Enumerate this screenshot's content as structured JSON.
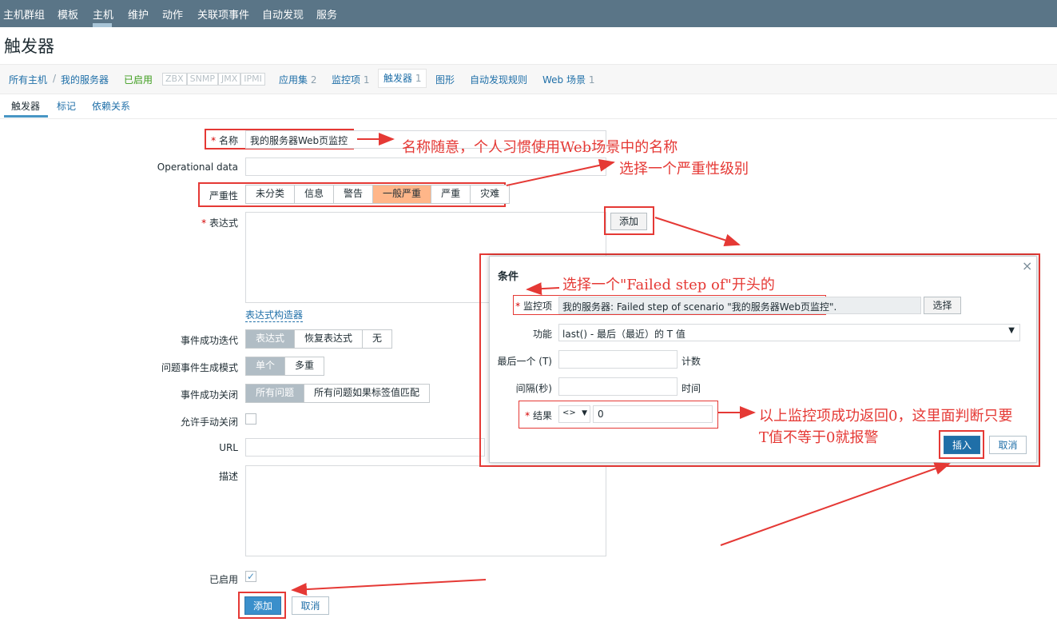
{
  "topnav": {
    "items": [
      "主机群组",
      "模板",
      "主机",
      "维护",
      "动作",
      "关联项事件",
      "自动发现",
      "服务"
    ]
  },
  "page_title": "触发器",
  "breadcrumb": {
    "all_hosts": "所有主机",
    "sep": "/",
    "host": "我的服务器",
    "status": "已启用",
    "tags": [
      "ZBX",
      "SNMP",
      "JMX",
      "IPMI"
    ],
    "apps": "应用集",
    "apps_count": "2",
    "items": "监控项",
    "items_count": "1",
    "triggers": "触发器",
    "triggers_count": "1",
    "graphs": "图形",
    "discovery": "自动发现规则",
    "web": "Web 场景",
    "web_count": "1"
  },
  "tabs": [
    "触发器",
    "标记",
    "依赖关系"
  ],
  "form": {
    "name_label": "名称",
    "name_value": "我的服务器Web页监控",
    "opdata_label": "Operational data",
    "severity_label": "严重性",
    "severity_options": [
      "未分类",
      "信息",
      "警告",
      "一般严重",
      "严重",
      "灾难"
    ],
    "expression_label": "表达式",
    "add_button": "添加",
    "expression_builder": "表达式构造器",
    "ok_event_label": "事件成功迭代",
    "ok_event_options": [
      "表达式",
      "恢复表达式",
      "无"
    ],
    "problem_mode_label": "问题事件生成模式",
    "problem_mode_options": [
      "单个",
      "多重"
    ],
    "ok_close_label": "事件成功关闭",
    "ok_close_options": [
      "所有问题",
      "所有问题如果标签值匹配"
    ],
    "manual_close_label": "允许手动关闭",
    "url_label": "URL",
    "desc_label": "描述",
    "enabled_label": "已启用",
    "submit_button": "添加",
    "cancel_button": "取消"
  },
  "dialog": {
    "title": "条件",
    "close": "×",
    "item_label": "监控项",
    "item_value": "我的服务器: Failed step of scenario \"我的服务器Web页监控\".",
    "select_button": "选择",
    "function_label": "功能",
    "function_value": "last() - 最后（最近）的 T 值",
    "last_label": "最后一个 (T)",
    "last_unit": "计数",
    "interval_label": "间隔(秒)",
    "interval_unit": "时间",
    "result_label": "结果",
    "result_op": "<>",
    "result_value": "0",
    "insert_button": "插入",
    "cancel_button": "取消"
  },
  "annotations": {
    "a1": "名称随意，个人习惯使用Web场景中的名称",
    "a2": "选择一个严重性级别",
    "a3": "选择一个\"Failed step of\"开头的",
    "a4_line1": "以上监控项成功返回0，这里面判断只要",
    "a4_line2": "T值不等于0就报警"
  },
  "colors": {
    "nav_bg": "#5a7587",
    "link": "#1f6fa8",
    "primary_button": "#3a8fcb",
    "severity_average": "#ffb689",
    "annotation_red": "#e53935"
  }
}
